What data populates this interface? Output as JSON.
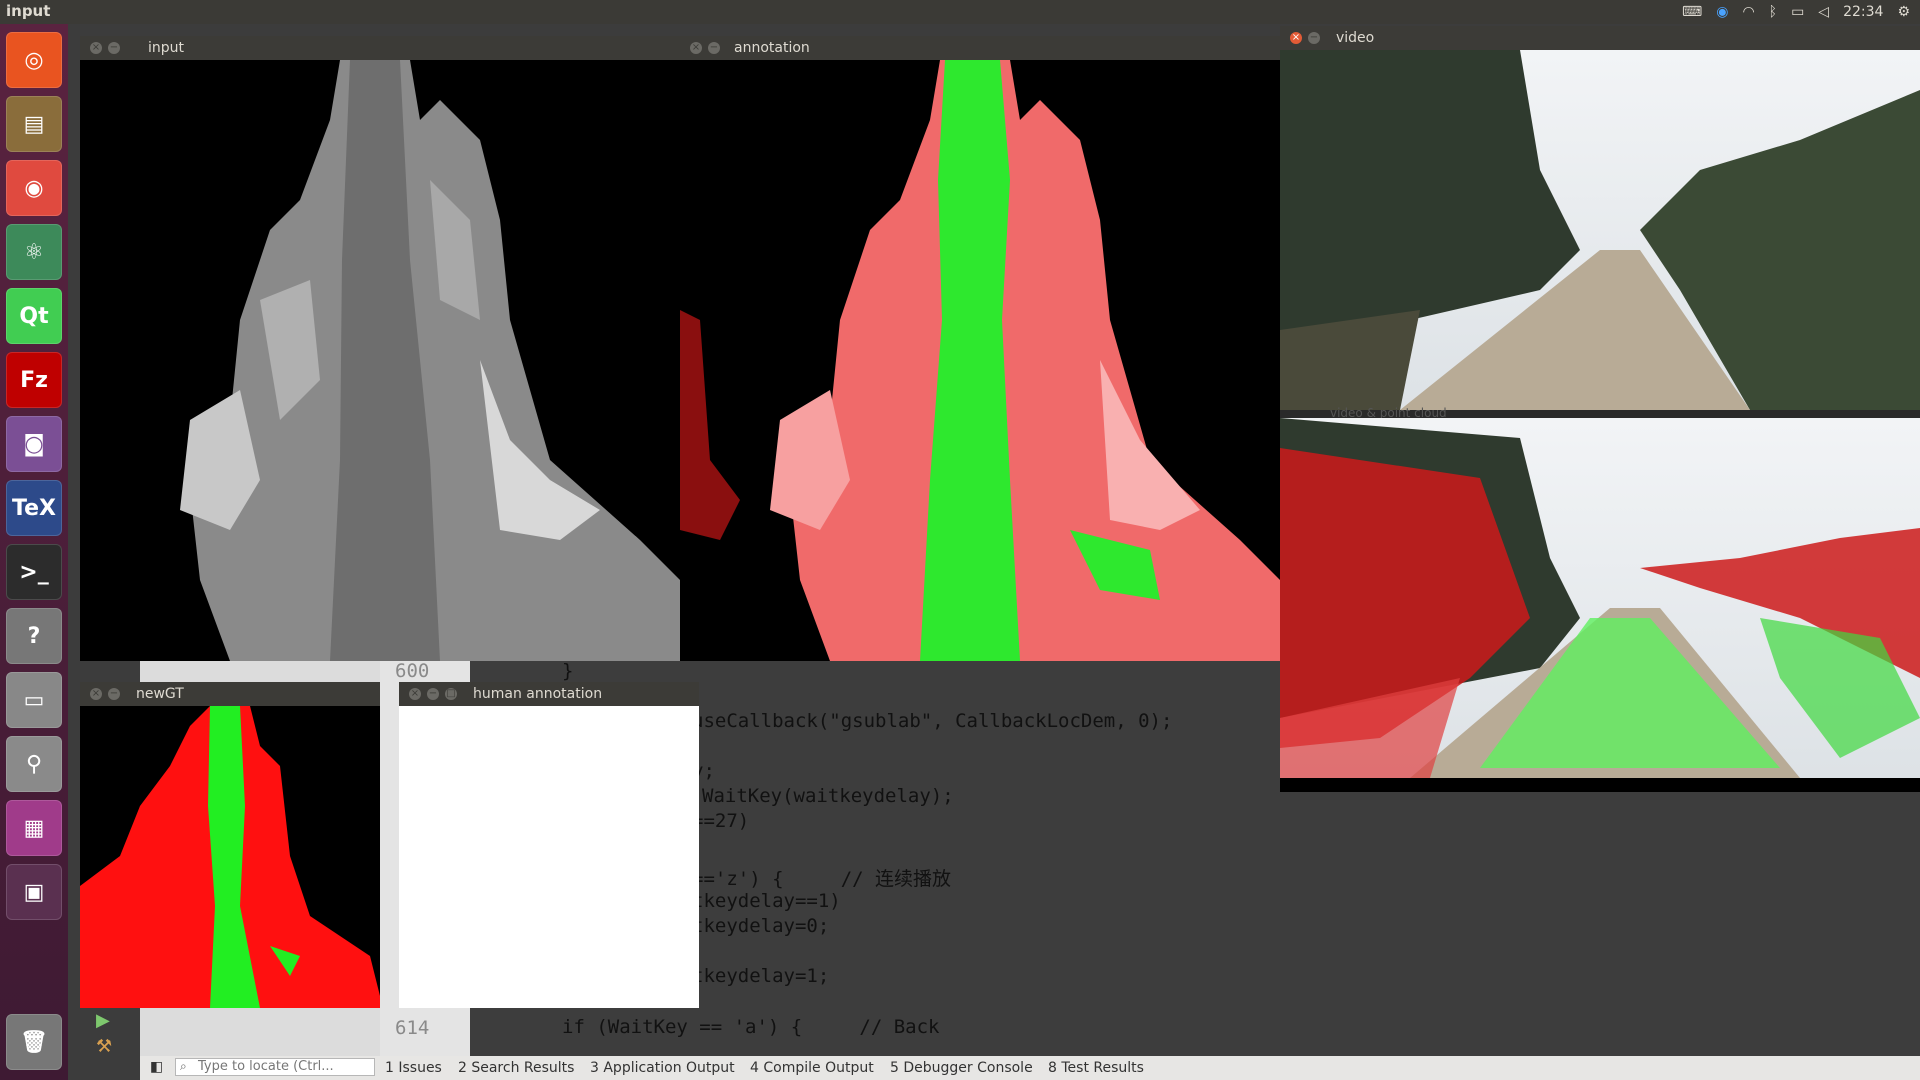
{
  "panel": {
    "app_name": "input",
    "time": "22:34"
  },
  "launcher": {
    "items": [
      {
        "name": "dash-home",
        "glyph": "◎",
        "color": "#e95420"
      },
      {
        "name": "files",
        "glyph": "▤",
        "color": "#8a6d3b"
      },
      {
        "name": "chrome",
        "glyph": "◉",
        "color": "#e04a3f"
      },
      {
        "name": "atom",
        "glyph": "⚛",
        "color": "#3d8a5a"
      },
      {
        "name": "qt-creator",
        "glyph": "Qt",
        "color": "#41cd52"
      },
      {
        "name": "filezilla",
        "glyph": "Fz",
        "color": "#bf0000"
      },
      {
        "name": "webcam",
        "glyph": "◙",
        "color": "#7b4f95"
      },
      {
        "name": "texmaker",
        "glyph": "TeX",
        "color": "#2d4a8a"
      },
      {
        "name": "terminal",
        "glyph": ">_",
        "color": "#2c2c2c"
      },
      {
        "name": "help",
        "glyph": "?",
        "color": "#777777"
      },
      {
        "name": "disk",
        "glyph": "▭",
        "color": "#888888"
      },
      {
        "name": "usb-installer",
        "glyph": "⚲",
        "color": "#8a8a8a"
      },
      {
        "name": "unity-window",
        "glyph": "▦",
        "color": "#a03b8a"
      },
      {
        "name": "workspaces",
        "glyph": "▣",
        "color": "#5a3050"
      },
      {
        "name": "trash",
        "glyph": "🗑",
        "color": "#777777"
      }
    ]
  },
  "windows": {
    "input": {
      "title": "input"
    },
    "annotation": {
      "title": "annotation"
    },
    "video": {
      "title": "video",
      "lower_caption": "video & point cloud"
    },
    "newgt": {
      "title": "newGT"
    },
    "human": {
      "title": "human annotation"
    }
  },
  "editor": {
    "line_numbers": [
      "600",
      "614"
    ],
    "lines": [
      {
        "text": "}",
        "cls": "dark"
      },
      {
        "text": "useCallback(\"gsublab\", CallbackLocDem, 0);",
        "cls": "dark"
      },
      {
        "text": "y;",
        "cls": "dark"
      },
      {
        "text": "WaitKey(waitkeydelay);",
        "cls": "dark"
      },
      {
        "text": "==27)",
        "cls": "dark"
      },
      {
        "text": "=='z') {     // 连续播放",
        "cls": "dark"
      },
      {
        "text": "tkeydelay==1)",
        "cls": "dark"
      },
      {
        "text": "tkeydelay=0;",
        "cls": "dark"
      },
      {
        "text": "tkeydelay=1;",
        "cls": "dark"
      },
      {
        "text": "if (WaitKey == 'a') {     // Back",
        "cls": "dark"
      }
    ]
  },
  "bottombar": {
    "locate_placeholder": "Type to locate (Ctrl...",
    "tabs": [
      "1  Issues",
      "2  Search Results",
      "3  Application Output",
      "4  Compile Output",
      "5  Debugger Console",
      "8  Test Results"
    ]
  },
  "colors": {
    "launcher_bg": "#5a2340",
    "titlebar_bg": "#3c3b37",
    "close_btn": "#e35b36",
    "annotation_red": "#f06060",
    "annotation_green": "#2ee82e"
  }
}
